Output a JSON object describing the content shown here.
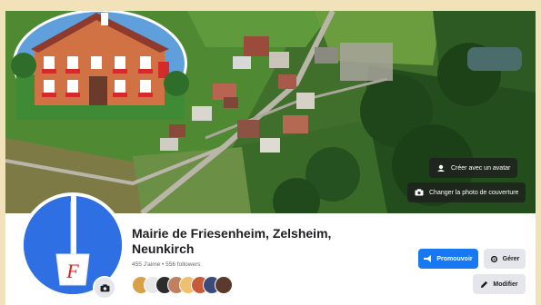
{
  "page": {
    "name": "Mairie de Friesenheim, Zelsheim, Neunkirch",
    "stats": "455 J'aime • 556 followers"
  },
  "cover_buttons": {
    "avatar_label": "Créer avec un avatar",
    "cover_label": "Changer la photo de couverture"
  },
  "actions": {
    "promote_label": "Promouvoir",
    "manage_label": "Gérer",
    "edit_label": "Modifier"
  },
  "profile": {
    "logo_letter": "F"
  },
  "follower_avatar_count": 8,
  "colors": {
    "brand_blue": "#1877f2",
    "profile_bg": "#2f6fe4",
    "logo_letter": "#e0201b",
    "page_background": "#f2e2ba"
  }
}
